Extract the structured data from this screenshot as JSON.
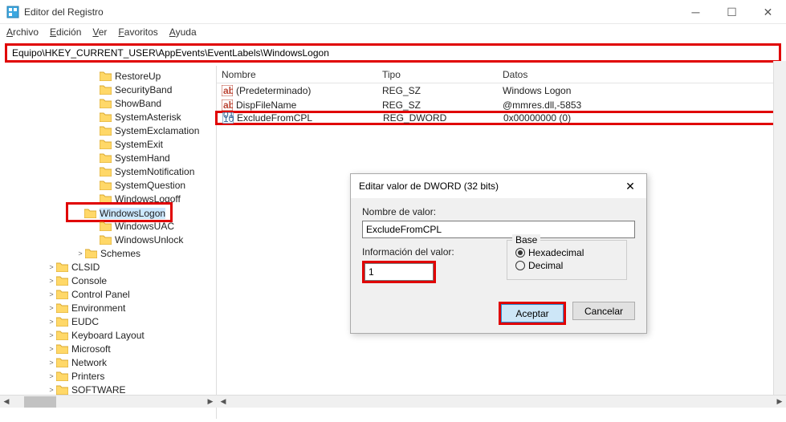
{
  "window": {
    "title": "Editor del Registro"
  },
  "menu": {
    "archivo": "Archivo",
    "edicion": "Edición",
    "ver": "Ver",
    "favoritos": "Favoritos",
    "ayuda": "Ayuda"
  },
  "address": {
    "value": "Equipo\\HKEY_CURRENT_USER\\AppEvents\\EventLabels\\WindowsLogon"
  },
  "tree": [
    {
      "indent": 112,
      "label": "RestoreUp"
    },
    {
      "indent": 112,
      "label": "SecurityBand"
    },
    {
      "indent": 112,
      "label": "ShowBand"
    },
    {
      "indent": 112,
      "label": "SystemAsterisk"
    },
    {
      "indent": 112,
      "label": "SystemExclamation"
    },
    {
      "indent": 112,
      "label": "SystemExit"
    },
    {
      "indent": 112,
      "label": "SystemHand"
    },
    {
      "indent": 112,
      "label": "SystemNotification"
    },
    {
      "indent": 112,
      "label": "SystemQuestion"
    },
    {
      "indent": 112,
      "label": "WindowsLogoff"
    },
    {
      "indent": 112,
      "label": "WindowsLogon",
      "selected": true,
      "highlight": true
    },
    {
      "indent": 112,
      "label": "WindowsUAC"
    },
    {
      "indent": 112,
      "label": "WindowsUnlock"
    },
    {
      "indent": 94,
      "chev": ">",
      "label": "Schemes"
    },
    {
      "indent": 58,
      "chev": ">",
      "label": "CLSID"
    },
    {
      "indent": 58,
      "chev": ">",
      "label": "Console"
    },
    {
      "indent": 58,
      "chev": ">",
      "label": "Control Panel"
    },
    {
      "indent": 58,
      "chev": ">",
      "label": "Environment"
    },
    {
      "indent": 58,
      "chev": ">",
      "label": "EUDC"
    },
    {
      "indent": 58,
      "chev": ">",
      "label": "Keyboard Layout"
    },
    {
      "indent": 58,
      "chev": ">",
      "label": "Microsoft"
    },
    {
      "indent": 58,
      "chev": ">",
      "label": "Network"
    },
    {
      "indent": 58,
      "chev": ">",
      "label": "Printers"
    },
    {
      "indent": 58,
      "chev": ">",
      "label": "SOFTWARE"
    }
  ],
  "list": {
    "headers": {
      "name": "Nombre",
      "type": "Tipo",
      "data": "Datos"
    },
    "rows": [
      {
        "icon": "ab",
        "name": "(Predeterminado)",
        "type": "REG_SZ",
        "data": "Windows Logon"
      },
      {
        "icon": "ab",
        "name": "DispFileName",
        "type": "REG_SZ",
        "data": "@mmres.dll,-5853"
      },
      {
        "icon": "bin",
        "name": "ExcludeFromCPL",
        "type": "REG_DWORD",
        "data": "0x00000000 (0)",
        "highlight": true
      }
    ]
  },
  "dialog": {
    "title": "Editar valor de DWORD (32 bits)",
    "name_label": "Nombre de valor:",
    "name_value": "ExcludeFromCPL",
    "info_label": "Información del valor:",
    "info_value": "1",
    "base_label": "Base",
    "hex_label": "Hexadecimal",
    "dec_label": "Decimal",
    "ok": "Aceptar",
    "cancel": "Cancelar"
  }
}
